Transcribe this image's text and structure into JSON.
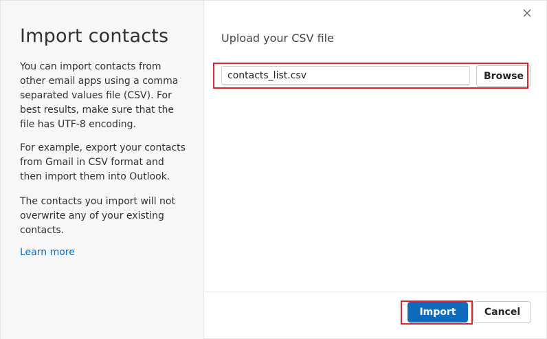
{
  "left_pane": {
    "title": "Import contacts",
    "paragraph_1": "You can import contacts from other email apps using a comma separated values file (CSV). For best results, make sure that the file has UTF-8 encoding.",
    "paragraph_2": "For example, export your contacts from Gmail in CSV format and then import them into Outlook.",
    "paragraph_3": "The contacts you import will not overwrite any of your existing contacts.",
    "learn_more": "Learn more"
  },
  "main": {
    "upload_title": "Upload your CSV file",
    "file_value": "contacts_list.csv",
    "browse_label": "Browse"
  },
  "footer": {
    "import_label": "Import",
    "cancel_label": "Cancel"
  },
  "icons": {
    "close": "close-icon"
  },
  "colors": {
    "accent": "#0f6cbd",
    "highlight": "#e0242e",
    "left_pane_bg": "#f7f7f7"
  }
}
